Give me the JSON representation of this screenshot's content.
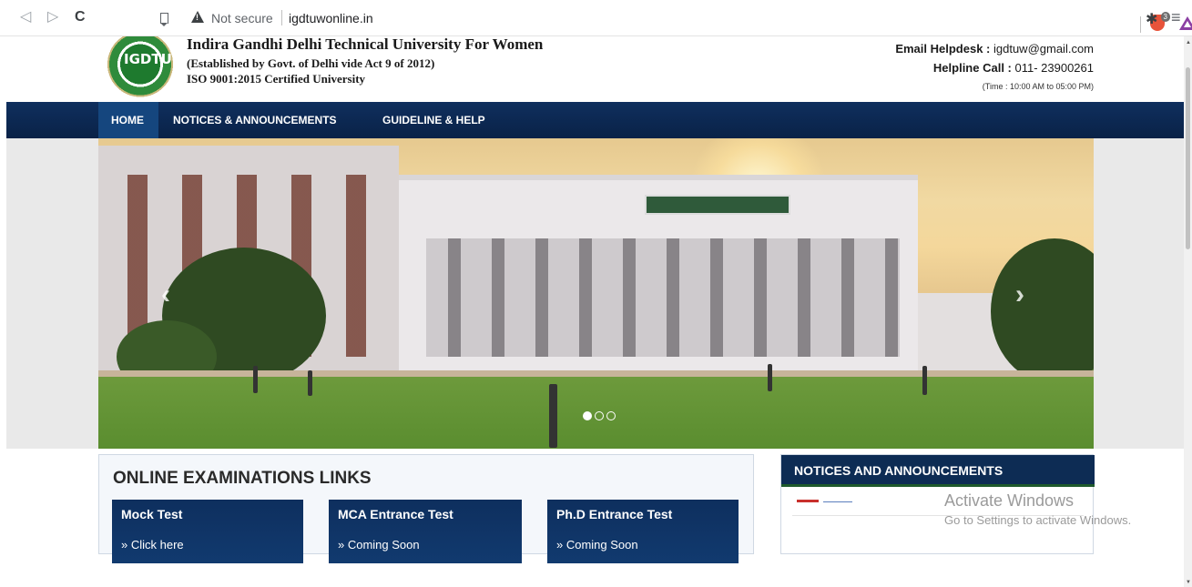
{
  "browser": {
    "security_label": "Not secure",
    "url": "igdtuwonline.in",
    "brave_badge": "3"
  },
  "header": {
    "logo_text": "IGDTU",
    "title": "Indira Gandhi Delhi Technical University For Women",
    "subtitle": "(Established by Govt. of Delhi vide Act 9 of 2012)",
    "iso": "ISO 9001:2015 Certified University",
    "email_label": "Email Helpdesk :",
    "email_value": " igdtuw@gmail.com",
    "helpline_label": "Helpline Call :",
    "helpline_value": " 011- 23900261",
    "time": "(Time : 10:00 AM to 05:00 PM)"
  },
  "nav": {
    "home": "HOME",
    "notices": "NOTICES & ANNOUNCEMENTS",
    "guideline": "GUIDELINE & HELP"
  },
  "carousel": {
    "prev_label": "‹",
    "next_label": "›",
    "slide_count": 3,
    "active_index": 0
  },
  "exams": {
    "title": "ONLINE EXAMINATIONS LINKS",
    "cards": [
      {
        "title": "Mock Test",
        "link": "» Click here"
      },
      {
        "title": "MCA Entrance Test",
        "link": "» Coming Soon"
      },
      {
        "title": "Ph.D Entrance Test",
        "link": "» Coming Soon"
      }
    ]
  },
  "notices": {
    "title": "NOTICES AND ANNOUNCEMENTS"
  },
  "watermark": {
    "line1": "Activate Windows",
    "line2": "Go to Settings to activate Windows."
  },
  "colors": {
    "nav_bg": "#0f2f5e",
    "nav_active": "#15467e",
    "card_bg": "#0e2f5e"
  }
}
